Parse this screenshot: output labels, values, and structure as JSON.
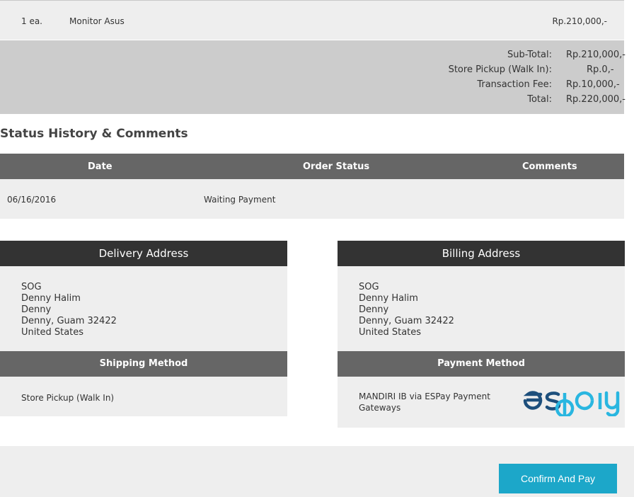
{
  "order_item": {
    "qty": "1 ea.",
    "name": "Monitor Asus",
    "price": "Rp.210,000,-"
  },
  "totals": [
    {
      "label": "Sub-Total:",
      "value": "Rp.210,000,-"
    },
    {
      "label": "Store Pickup (Walk In):",
      "value": "Rp.0,-"
    },
    {
      "label": "Transaction Fee:",
      "value": "Rp.10,000,-"
    },
    {
      "label": "Total:",
      "value": "Rp.220,000,-"
    }
  ],
  "status_history": {
    "title": "Status History & Comments",
    "columns": [
      "Date",
      "Order Status",
      "Comments"
    ],
    "rows": [
      {
        "date": "06/16/2016",
        "status": "Waiting Payment",
        "comment": ""
      }
    ]
  },
  "delivery": {
    "title": "Delivery Address",
    "lines": [
      "SOG",
      "Denny Halim",
      "Denny",
      "Denny, Guam 32422",
      "United States"
    ],
    "method_title": "Shipping Method",
    "method": "Store Pickup (Walk In)"
  },
  "billing": {
    "title": "Billing Address",
    "lines": [
      "SOG",
      "Denny Halim",
      "Denny",
      "Denny, Guam 32422",
      "United States"
    ],
    "method_title": "Payment Method",
    "method_line1": "MANDIRI IB via ESPay Payment",
    "method_line2": "Gateways",
    "logo_text": "espay"
  },
  "actions": {
    "confirm_label": "Confirm And Pay"
  },
  "colors": {
    "accent": "#1ca7c9",
    "logo_dark": "#1d4f7c",
    "logo_light": "#29b6e0"
  }
}
